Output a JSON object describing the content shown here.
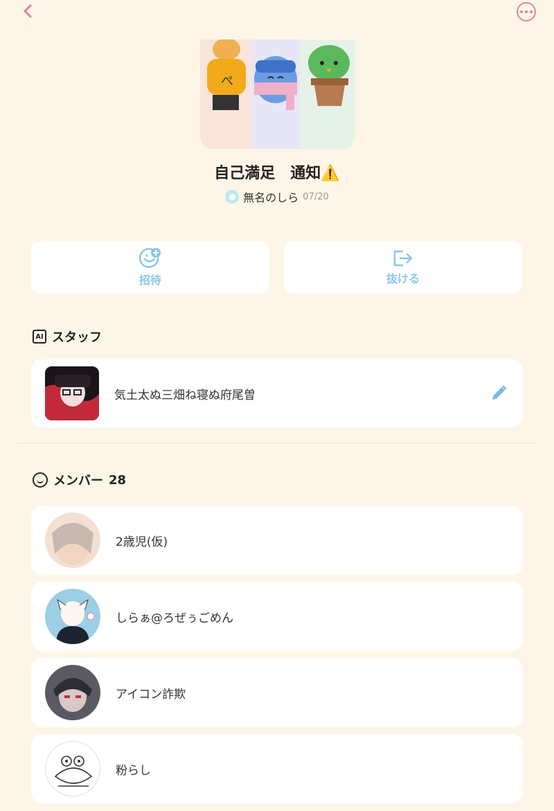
{
  "group": {
    "title": "自己満足　通知⚠️",
    "creator_name": "無名のしら",
    "created_date": "07/20"
  },
  "actions": {
    "invite_label": "招待",
    "leave_label": "抜ける"
  },
  "staff": {
    "heading": "スタッフ",
    "badge": "AI",
    "members": [
      {
        "name": "気土太ぬ三畑ね寝ぬ府尾曽"
      }
    ]
  },
  "members": {
    "heading": "メンバー",
    "count": "28",
    "list": [
      {
        "name": "2歳児(仮)"
      },
      {
        "name": "しらぁ@ろぜぅごめん"
      },
      {
        "name": "アイコン詐欺"
      },
      {
        "name": "粉らし"
      }
    ]
  },
  "colors": {
    "background": "#fdf6e8",
    "accent_pink": "#e4848f",
    "accent_blue": "#8cc6e6",
    "card": "#ffffff"
  },
  "icons": [
    "chevron-left-icon",
    "more-icon",
    "invite-icon",
    "leave-icon",
    "ai-icon",
    "smile-icon",
    "pencil-icon"
  ]
}
